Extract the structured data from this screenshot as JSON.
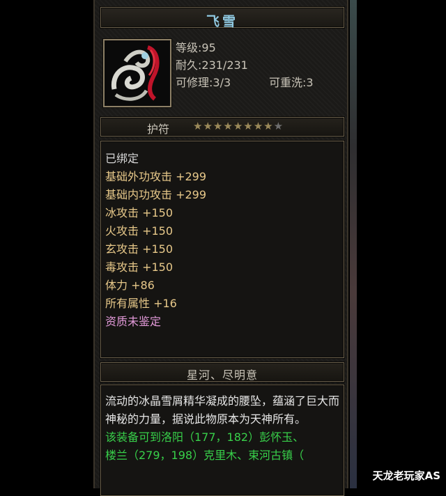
{
  "item": {
    "name": "飞雪",
    "stats": {
      "level": "等级:95",
      "durability": "耐久:231/231",
      "repairable": "可修理:3/3",
      "rewashable": "可重洗:3"
    },
    "type": "护符",
    "stars_total": 9,
    "stars_filled": 8,
    "attributes": {
      "bound": "已绑定",
      "base_ext_attack": "基础外功攻击 +299",
      "base_int_attack": "基础内功攻击 +299",
      "ice_attack": "冰攻击 +150",
      "fire_attack": "火攻击 +150",
      "mystic_attack": "玄攻击 +150",
      "poison_attack": "毒攻击 +150",
      "stamina": "体力 +86",
      "all_attributes": "所有属性 +16",
      "aptitude": "资质未鉴定"
    },
    "set_name": "星河、尽明意",
    "description": "流动的冰晶雪屑精华凝成的腰坠，蕴涵了巨大而神秘的力量，据说此物原本为天神所有。",
    "obtain_info_line1": "该装备可到洛阳（177，182）彭怀玉、",
    "obtain_info_line2": "楼兰（279，198）克里木、束河古镇（"
  },
  "watermark": "天龙老玩家AS",
  "colors": {
    "title": "#8fc8e0",
    "stat_gold": "#e8c98a",
    "aptitude_pink": "#e39ad9",
    "obtain_green": "#38d04a"
  }
}
